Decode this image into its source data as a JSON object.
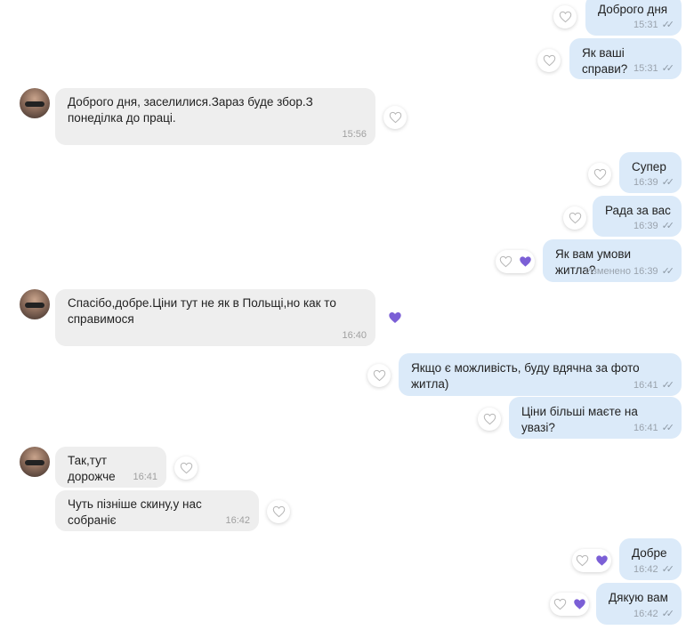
{
  "colors": {
    "outgoing_bubble": "#dbeaf9",
    "incoming_bubble": "#eeeeee",
    "reaction_heart": "#7b5fd6"
  },
  "messages": [
    {
      "dir": "out",
      "text": "Доброго дня",
      "time": "15:31"
    },
    {
      "dir": "out",
      "text": "Як ваші справи?",
      "time": "15:31"
    },
    {
      "dir": "in",
      "text": "Доброго дня, заселилися.Зараз буде збор.З понеділка до праці.",
      "time": "15:56"
    },
    {
      "dir": "out",
      "text": "Супер",
      "time": "16:39"
    },
    {
      "dir": "out",
      "text": "Рада за вас",
      "time": "16:39"
    },
    {
      "dir": "out",
      "text": "Як вам умови житла?",
      "time": "Изменено 16:39",
      "reaction": "heart"
    },
    {
      "dir": "in",
      "text": "Спасібо,добре.Ціни тут не як в Польщі,но как то справимося",
      "time": "16:40",
      "reaction": "heart"
    },
    {
      "dir": "out",
      "text": "Якщо є можливість, буду вдячна за фото житла)",
      "time": "16:41"
    },
    {
      "dir": "out",
      "text": "Ціни більші маєте на увазі?",
      "time": "16:41"
    },
    {
      "dir": "in",
      "text": "Так,тут дорожче",
      "time": "16:41"
    },
    {
      "dir": "in",
      "text": "Чуть пізніше скину,у нас собраніє",
      "time": "16:42"
    },
    {
      "dir": "out",
      "text": "Добре",
      "time": "16:42",
      "reaction": "heart"
    },
    {
      "dir": "out",
      "text": "Дякую вам",
      "time": "16:42",
      "reaction": "heart"
    }
  ]
}
